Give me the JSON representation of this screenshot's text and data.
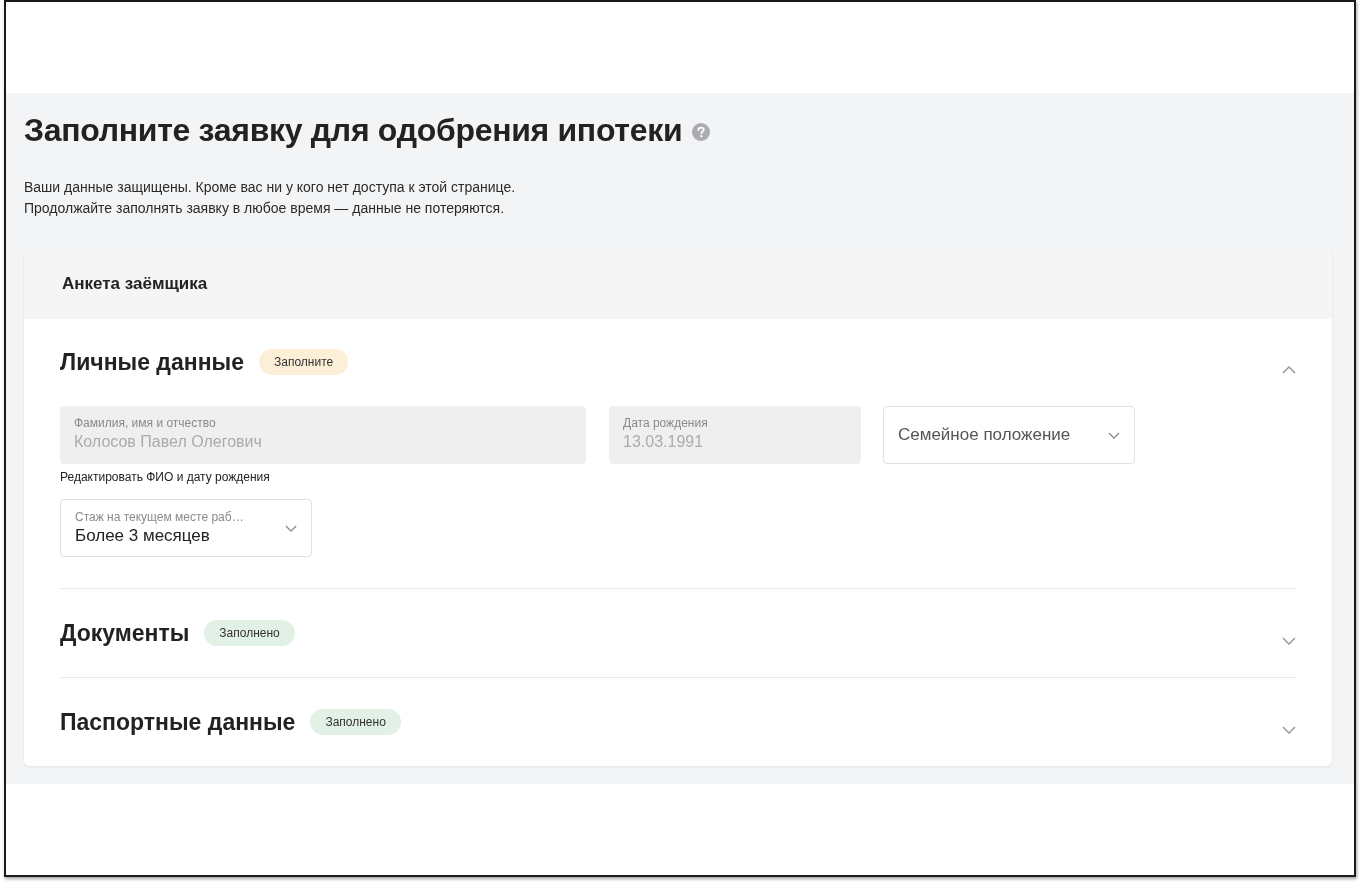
{
  "title": "Заполните заявку для одобрения ипотеки",
  "notice": [
    "Ваши данные защищены. Кроме вас ни у кого нет доступа к этой странице.",
    "Продолжайте заполнять заявку в любое время — данные не потеряются."
  ],
  "form": {
    "header": "Анкета заёмщика",
    "sections": [
      {
        "title": "Личные данные",
        "status": {
          "label": "Заполните",
          "kind": "pending"
        },
        "expanded": true,
        "content": [
          {
            "kind": "fields",
            "fields": [
              {
                "kind": "text",
                "label": "Фамилия, имя и отчество",
                "value": "Колосов Павел Олегович",
                "disabled": true
              },
              {
                "kind": "text",
                "label": "Дата рождения",
                "value": "13.03.1991",
                "disabled": true
              },
              {
                "kind": "select",
                "placeholder": "Семейное положение",
                "disabled": false
              }
            ]
          },
          {
            "kind": "link",
            "text": "Редактировать ФИО и дату рождения"
          },
          {
            "kind": "fields",
            "fields": [
              {
                "kind": "select",
                "label": "Стаж на текущем месте раб…",
                "value": "Более 3 месяцев",
                "disabled": false
              }
            ]
          }
        ]
      },
      {
        "title": "Документы",
        "status": {
          "label": "Заполнено",
          "kind": "done"
        },
        "expanded": false
      },
      {
        "title": "Паспортные данные",
        "status": {
          "label": "Заполнено",
          "kind": "done"
        },
        "expanded": false
      }
    ]
  }
}
